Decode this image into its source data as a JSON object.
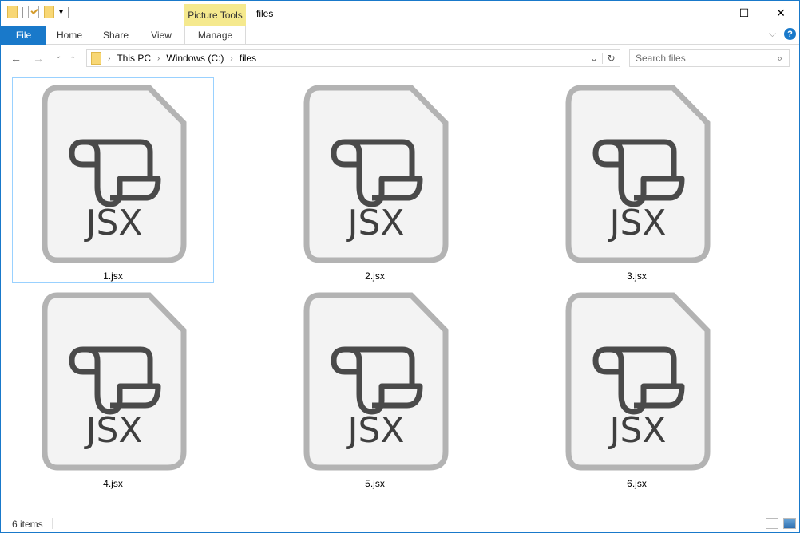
{
  "window": {
    "title": "files",
    "context_tab": "Picture Tools",
    "min": "—",
    "max": "☐",
    "close": "✕"
  },
  "ribbon": {
    "tabs": [
      "File",
      "Home",
      "Share",
      "View",
      "Manage"
    ],
    "help": "?",
    "collapse": "⌵"
  },
  "nav": {
    "back": "←",
    "forward": "→",
    "recent": "⌄",
    "up": "↑",
    "breadcrumb": [
      "This PC",
      "Windows (C:)",
      "files"
    ],
    "separator": "›",
    "dropdown": "⌄",
    "refresh": "↻"
  },
  "search": {
    "placeholder": "Search files",
    "icon": "⌕"
  },
  "files": [
    {
      "name": "1.jsx",
      "selected": true
    },
    {
      "name": "2.jsx"
    },
    {
      "name": "3.jsx"
    },
    {
      "name": "4.jsx"
    },
    {
      "name": "5.jsx"
    },
    {
      "name": "6.jsx"
    }
  ],
  "icon_text": "JSX",
  "status": {
    "count": "6 items"
  }
}
